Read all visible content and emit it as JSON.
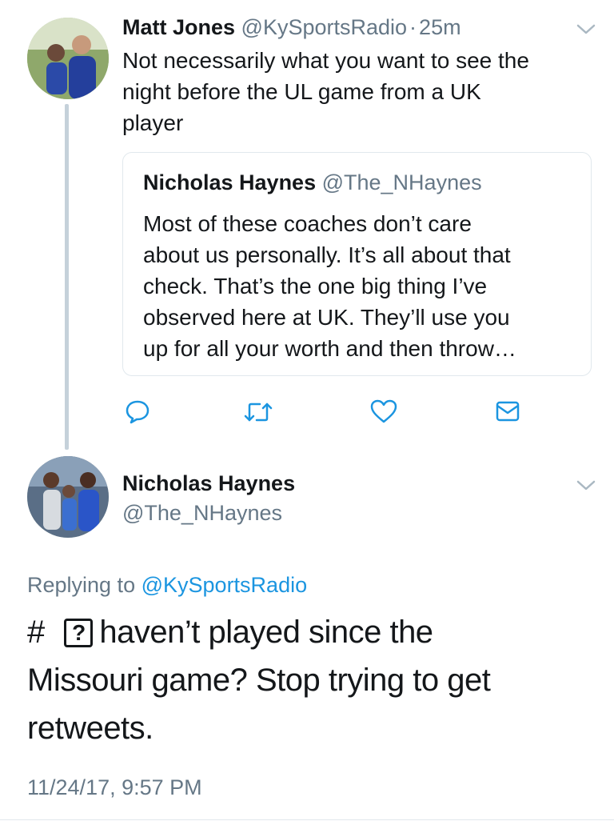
{
  "tweet1": {
    "display_name": "Matt Jones",
    "handle": "@KySportsRadio",
    "separator": "·",
    "time": "25m",
    "text_lines": [
      "Not necessarily what you want to see the",
      "night before the UL game from a UK",
      "player"
    ],
    "quote": {
      "display_name": "Nicholas Haynes",
      "handle": "@The_NHaynes",
      "text_lines": [
        "Most of these coaches don’t care",
        "about us personally. It’s all about that",
        "check. That’s the one big thing I’ve",
        "observed here at UK. They’ll use you",
        "up for all your worth and then throw…"
      ]
    },
    "actions": [
      "reply-icon",
      "retweet-icon",
      "like-icon",
      "message-icon"
    ]
  },
  "tweet2": {
    "display_name": "Nicholas Haynes",
    "handle": "@The_NHaynes",
    "replying_prefix": "Replying to",
    "replying_handle": "@KySportsRadio",
    "text_hash": "#",
    "text_unknown_glyph": "?",
    "text_line1_rest": "haven’t played since the",
    "text_lines": [
      "Missouri game? Stop trying to get",
      "retweets."
    ],
    "timestamp": "11/24/17, 9:57 PM"
  },
  "colors": {
    "link": "#1b95e0",
    "muted": "#657786",
    "thread_line": "#c5d1da",
    "border": "#e1e8ed"
  }
}
